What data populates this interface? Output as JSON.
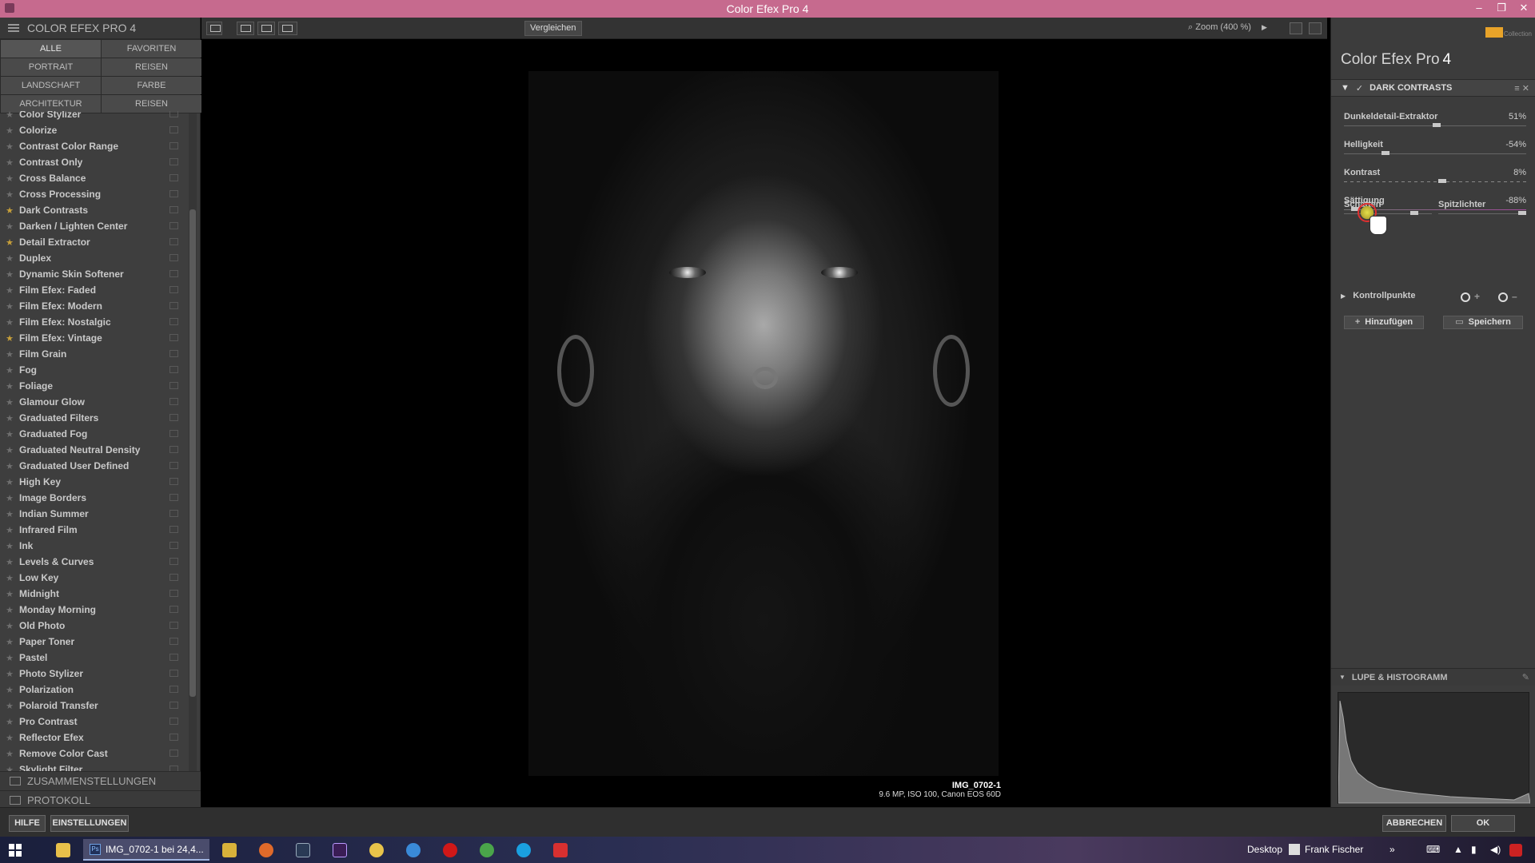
{
  "window": {
    "title": "Color Efex Pro 4",
    "buttons": [
      "–",
      "❐",
      "✕"
    ]
  },
  "left_panel": {
    "header": "COLOR EFEX PRO 4",
    "categories": [
      {
        "label": "ALLE",
        "active": true
      },
      {
        "label": "FAVORITEN",
        "active": false
      },
      {
        "label": "PORTRAIT",
        "active": false
      },
      {
        "label": "REISEN",
        "active": false
      },
      {
        "label": "LANDSCHAFT",
        "active": false
      },
      {
        "label": "FARBE",
        "active": false
      },
      {
        "label": "ARCHITEKTUR",
        "active": false
      },
      {
        "label": "REISEN",
        "active": false
      }
    ],
    "filters": [
      {
        "name": "Color Stylizer",
        "fav": false
      },
      {
        "name": "Colorize",
        "fav": false
      },
      {
        "name": "Contrast Color Range",
        "fav": false
      },
      {
        "name": "Contrast Only",
        "fav": false
      },
      {
        "name": "Cross Balance",
        "fav": false
      },
      {
        "name": "Cross Processing",
        "fav": false
      },
      {
        "name": "Dark Contrasts",
        "fav": true
      },
      {
        "name": "Darken / Lighten Center",
        "fav": false
      },
      {
        "name": "Detail Extractor",
        "fav": true
      },
      {
        "name": "Duplex",
        "fav": false
      },
      {
        "name": "Dynamic Skin Softener",
        "fav": false
      },
      {
        "name": "Film Efex: Faded",
        "fav": false
      },
      {
        "name": "Film Efex: Modern",
        "fav": false
      },
      {
        "name": "Film Efex: Nostalgic",
        "fav": false
      },
      {
        "name": "Film Efex: Vintage",
        "fav": true
      },
      {
        "name": "Film Grain",
        "fav": false
      },
      {
        "name": "Fog",
        "fav": false
      },
      {
        "name": "Foliage",
        "fav": false
      },
      {
        "name": "Glamour Glow",
        "fav": false
      },
      {
        "name": "Graduated Filters",
        "fav": false
      },
      {
        "name": "Graduated Fog",
        "fav": false
      },
      {
        "name": "Graduated Neutral Density",
        "fav": false
      },
      {
        "name": "Graduated User Defined",
        "fav": false
      },
      {
        "name": "High Key",
        "fav": false
      },
      {
        "name": "Image Borders",
        "fav": false
      },
      {
        "name": "Indian Summer",
        "fav": false
      },
      {
        "name": "Infrared Film",
        "fav": false
      },
      {
        "name": "Ink",
        "fav": false
      },
      {
        "name": "Levels & Curves",
        "fav": false
      },
      {
        "name": "Low Key",
        "fav": false
      },
      {
        "name": "Midnight",
        "fav": false
      },
      {
        "name": "Monday Morning",
        "fav": false
      },
      {
        "name": "Old Photo",
        "fav": false
      },
      {
        "name": "Paper Toner",
        "fav": false
      },
      {
        "name": "Pastel",
        "fav": false
      },
      {
        "name": "Photo Stylizer",
        "fav": false
      },
      {
        "name": "Polarization",
        "fav": false
      },
      {
        "name": "Polaroid Transfer",
        "fav": false
      },
      {
        "name": "Pro Contrast",
        "fav": false
      },
      {
        "name": "Reflector Efex",
        "fav": false
      },
      {
        "name": "Remove Color Cast",
        "fav": false
      },
      {
        "name": "Skylight Filter",
        "fav": false
      }
    ],
    "sections": {
      "presets": "ZUSAMMENSTELLUNGEN",
      "history": "PROTOKOLL"
    }
  },
  "toolbar": {
    "compare_label": "Vergleichen",
    "zoom_label": "Zoom (400 %)"
  },
  "image": {
    "name": "IMG_0702-1",
    "meta": "9.6 MP, ISO 100, Canon EOS 60D"
  },
  "right_panel": {
    "brand_text": "Collection",
    "app_title": "Color Efex Pro",
    "app_version": "4",
    "filter_name": "DARK CONTRASTS",
    "params": [
      {
        "label": "Dunkeldetail-Extraktor",
        "value": "51%",
        "level": 0.51
      },
      {
        "label": "Helligkeit",
        "value": "-54%",
        "level": 0.23
      },
      {
        "label": "Kontrast",
        "value": "8%",
        "level": 0.54
      },
      {
        "label": "Sättigung",
        "value": "-88%",
        "level": 0.06
      }
    ],
    "shadows_label": "Schatten",
    "highlights_label": "Spitzlichter",
    "shadows_level": 0.8,
    "highlights_level": 0.95,
    "control_points_label": "Kontrollpunkte",
    "add_label": "Hinzufügen",
    "save_label": "Speichern",
    "histogram_label": "LUPE & HISTOGRAMM"
  },
  "bottom_bar": {
    "help": "HILFE",
    "settings": "EINSTELLUNGEN",
    "cancel": "ABBRECHEN",
    "ok": "OK"
  },
  "taskbar": {
    "active_task": "IMG_0702-1 bei 24,4...",
    "desktop": "Desktop",
    "user": "Frank Fischer"
  },
  "colors": {
    "titlebar": "#c66a8e",
    "panel": "#3e3e3e",
    "favorite_star": "#c7a03a"
  }
}
